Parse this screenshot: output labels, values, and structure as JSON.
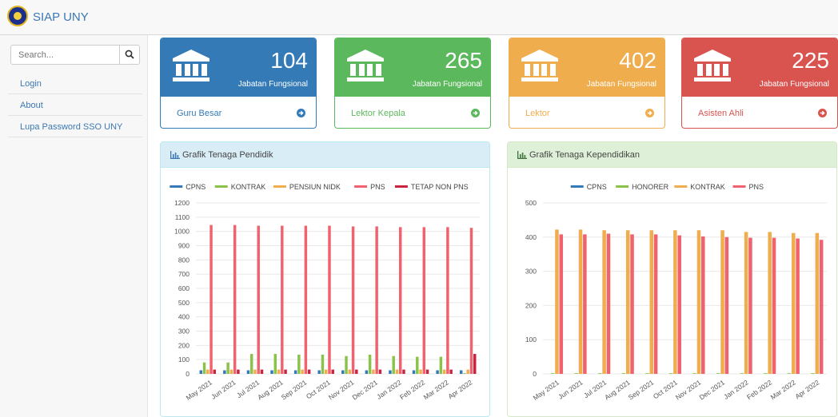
{
  "app": {
    "name": "SIAP UNY"
  },
  "sidebar": {
    "search_placeholder": "Search...",
    "items": [
      {
        "label": "Login"
      },
      {
        "label": "About"
      },
      {
        "label": "Lupa Password SSO UNY"
      }
    ]
  },
  "cards": [
    {
      "count": "104",
      "label": "Jabatan Fungsional",
      "footer": "Guru Besar",
      "color": "#337ab7",
      "icon": "bank-icon"
    },
    {
      "count": "265",
      "label": "Jabatan Fungsional",
      "footer": "Lektor Kepala",
      "color": "#5cb85c",
      "icon": "bank-icon"
    },
    {
      "count": "402",
      "label": "Jabatan Fungsional",
      "footer": "Lektor",
      "color": "#f0ad4e",
      "icon": "bank-icon"
    },
    {
      "count": "225",
      "label": "Jabatan Fungsional",
      "footer": "Asisten Ahli",
      "color": "#d9534f",
      "icon": "bank-icon"
    }
  ],
  "panels": [
    {
      "title": "Grafik Tenaga Pendidik",
      "icon": "bar-chart-icon"
    },
    {
      "title": "Grafik Tenaga Kependidikan",
      "icon": "bar-chart-icon"
    }
  ],
  "chart_data": [
    {
      "type": "bar",
      "categories": [
        "May 2021",
        "Jun 2021",
        "Jul 2021",
        "Aug 2021",
        "Sep 2021",
        "Oct 2021",
        "Nov 2021",
        "Dec 2021",
        "Jan 2022",
        "Feb 2022",
        "Mar 2022",
        "Apr 2022"
      ],
      "ylim": [
        0,
        1200
      ],
      "yticks": [
        0,
        100,
        200,
        300,
        400,
        500,
        600,
        700,
        800,
        900,
        1000,
        1100,
        1200
      ],
      "grid": true,
      "legend_position": "top",
      "series": [
        {
          "name": "CPNS",
          "color": "#337ab7",
          "values": [
            25,
            25,
            25,
            25,
            25,
            25,
            25,
            25,
            25,
            25,
            25,
            25
          ]
        },
        {
          "name": "KONTRAK",
          "color": "#8bc34a",
          "values": [
            80,
            80,
            140,
            140,
            135,
            135,
            125,
            135,
            125,
            120,
            120,
            5
          ]
        },
        {
          "name": "PENSIUN NIDK",
          "color": "#f0ad4e",
          "values": [
            30,
            30,
            30,
            30,
            30,
            30,
            30,
            30,
            30,
            30,
            30,
            30
          ]
        },
        {
          "name": "PNS",
          "color": "#f0626e",
          "values": [
            1045,
            1045,
            1040,
            1040,
            1040,
            1040,
            1035,
            1035,
            1030,
            1030,
            1030,
            1025
          ]
        },
        {
          "name": "TETAP NON PNS",
          "color": "#c9243f",
          "values": [
            30,
            30,
            30,
            30,
            30,
            30,
            30,
            30,
            30,
            30,
            30,
            140
          ]
        }
      ]
    },
    {
      "type": "bar",
      "categories": [
        "May 2021",
        "Jun 2021",
        "Jul 2021",
        "Aug 2021",
        "Sep 2021",
        "Oct 2021",
        "Nov 2021",
        "Dec 2021",
        "Jan 2022",
        "Feb 2022",
        "Mar 2022",
        "Apr 2022"
      ],
      "ylim": [
        0,
        500
      ],
      "yticks": [
        0,
        100,
        200,
        300,
        400,
        500
      ],
      "grid": true,
      "legend_position": "top",
      "series": [
        {
          "name": "CPNS",
          "color": "#337ab7",
          "values": [
            0,
            0,
            0,
            0,
            0,
            0,
            0,
            0,
            0,
            0,
            0,
            0
          ]
        },
        {
          "name": "HONORER",
          "color": "#8bc34a",
          "values": [
            2,
            2,
            2,
            2,
            2,
            2,
            2,
            2,
            2,
            2,
            2,
            2
          ]
        },
        {
          "name": "KONTRAK",
          "color": "#f0ad4e",
          "values": [
            422,
            422,
            420,
            420,
            420,
            420,
            420,
            420,
            415,
            415,
            412,
            412
          ]
        },
        {
          "name": "PNS",
          "color": "#f0626e",
          "values": [
            408,
            408,
            410,
            408,
            408,
            405,
            402,
            400,
            398,
            398,
            396,
            392
          ]
        }
      ]
    }
  ]
}
